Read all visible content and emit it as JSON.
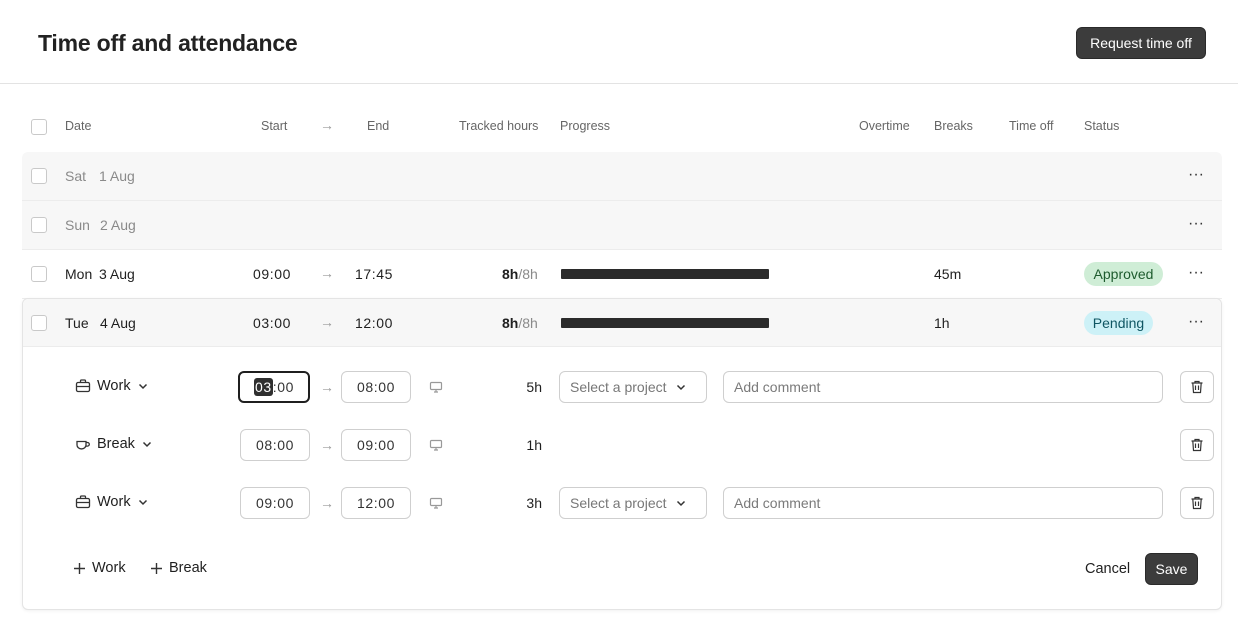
{
  "header": {
    "title": "Time off and attendance",
    "request_button": "Request time off"
  },
  "columns": {
    "date": "Date",
    "start": "Start",
    "end": "End",
    "tracked": "Tracked hours",
    "progress": "Progress",
    "overtime": "Overtime",
    "breaks": "Breaks",
    "time_off": "Time off",
    "status": "Status"
  },
  "rows": [
    {
      "day": "Sat",
      "date": "1 Aug"
    },
    {
      "day": "Sun",
      "date": "2 Aug"
    },
    {
      "day": "Mon",
      "date": "3 Aug",
      "start": "09:00",
      "end": "17:45",
      "tracked": "8h",
      "target": "/8h",
      "progress": 1.0,
      "breaks": "45m",
      "status": "Approved"
    },
    {
      "day": "Tue",
      "date": "4 Aug",
      "start": "03:00",
      "end": "12:00",
      "tracked": "8h",
      "target": "/8h",
      "progress": 1.0,
      "breaks": "1h",
      "status": "Pending"
    }
  ],
  "entries": [
    {
      "type": "Work",
      "start_hh": "03",
      "start_mm": ":00",
      "end": "08:00",
      "duration": "5h",
      "project_placeholder": "Select a project",
      "comment_placeholder": "Add comment"
    },
    {
      "type": "Break",
      "start": "08:00",
      "end": "09:00",
      "duration": "1h"
    },
    {
      "type": "Work",
      "start": "09:00",
      "end": "12:00",
      "duration": "3h",
      "project_placeholder": "Select a project",
      "comment_placeholder": "Add comment"
    }
  ],
  "actions": {
    "add_work": "Work",
    "add_break": "Break",
    "cancel": "Cancel",
    "save": "Save"
  },
  "icons": {
    "arrow": "→",
    "more": "···"
  },
  "colors": {
    "approved_bg": "#cfedd6",
    "pending_bg": "#cdf1f7",
    "dark_button": "#3c3c3c"
  }
}
